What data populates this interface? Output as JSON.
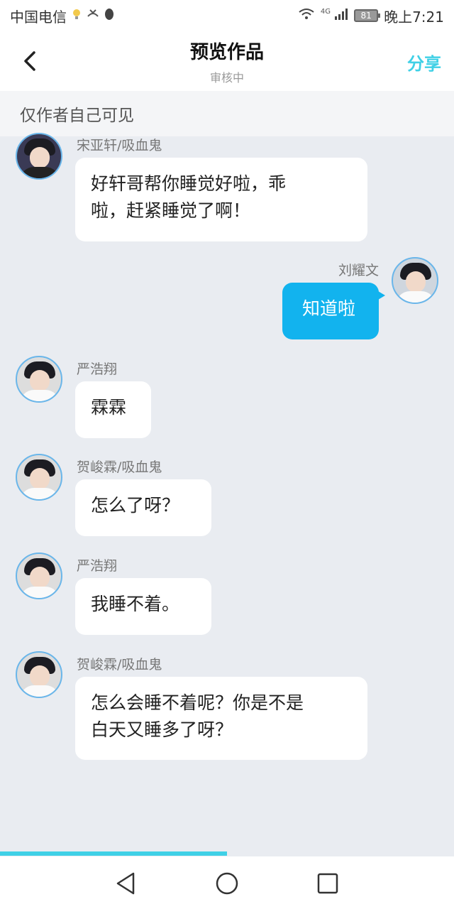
{
  "status_bar": {
    "carrier": "中国电信",
    "network": "4G",
    "battery": "81",
    "time": "晚上7:21"
  },
  "header": {
    "title": "预览作品",
    "subtitle": "审核中",
    "share_label": "分享"
  },
  "notice": "仅作者自己可见",
  "messages": [
    {
      "sender": "宋亚轩/吸血鬼",
      "text_lines": [
        "好轩哥帮你睡觉好啦，乖",
        "啦，赶紧睡觉了啊！"
      ],
      "side": "left"
    },
    {
      "sender": "刘耀文",
      "text_lines": [
        "知道啦"
      ],
      "side": "right"
    },
    {
      "sender": "严浩翔",
      "text_lines": [
        "霖霖"
      ],
      "side": "left"
    },
    {
      "sender": "贺峻霖/吸血鬼",
      "text_lines": [
        "怎么了呀？"
      ],
      "side": "left"
    },
    {
      "sender": "严浩翔",
      "text_lines": [
        "我睡不着。"
      ],
      "side": "left"
    },
    {
      "sender": "贺峻霖/吸血鬼",
      "text_lines": [
        "怎么会睡不着呢？你是不是",
        "白天又睡多了呀？"
      ],
      "side": "left"
    }
  ],
  "progress": {
    "fraction": 0.5,
    "color": "#3fd0e6"
  },
  "colors": {
    "accent": "#3fd0e6",
    "my_bubble": "#12b3ee",
    "avatar_ring": "#6ab6ea"
  },
  "icons": [
    "back-chevron-icon",
    "wifi-icon",
    "signal-icon",
    "battery-icon",
    "nav-back-icon",
    "nav-home-icon",
    "nav-recents-icon"
  ]
}
